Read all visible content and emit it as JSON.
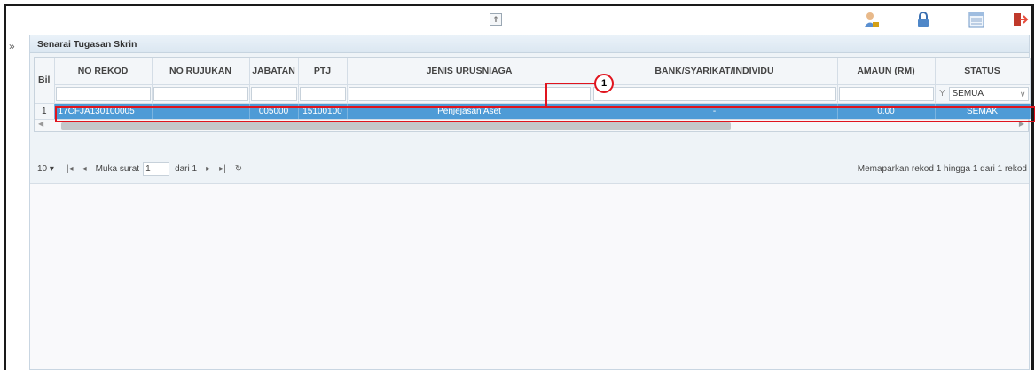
{
  "toolbar": {
    "collapse_glyph": "⇑",
    "icons": [
      "user-profile-icon",
      "lock-icon",
      "list-view-icon",
      "exit-icon"
    ]
  },
  "rail": {
    "toggle": "»"
  },
  "panel": {
    "title": "Senarai Tugasan Skrin"
  },
  "grid": {
    "columns": [
      "Bil",
      "NO REKOD",
      "NO RUJUKAN",
      "JABATAN",
      "PTJ",
      "JENIS URUSNIAGA",
      "BANK/SYARIKAT/INDIVIDU",
      "AMAUN (RM)",
      "STATUS"
    ],
    "status_filter": "SEMUA",
    "rows": [
      {
        "bil": "1",
        "no_rekod": "17CFJA130100005",
        "no_rujukan": "",
        "jabatan": "005000",
        "ptj": "15100100",
        "jenis_urusniaga": "Penjejasan Aset",
        "bank": "-",
        "amaun": "0.00",
        "status": "SEMAK"
      }
    ]
  },
  "pager": {
    "page_size": "10",
    "page_label": "Muka surat",
    "page_value": "1",
    "of_label": "dari 1",
    "info": "Memaparkan rekod 1 hingga 1 dari 1 rekod"
  },
  "callout": {
    "number": "1"
  },
  "colors": {
    "selected_row": "#4e9bd6",
    "callout": "#e0141e"
  }
}
